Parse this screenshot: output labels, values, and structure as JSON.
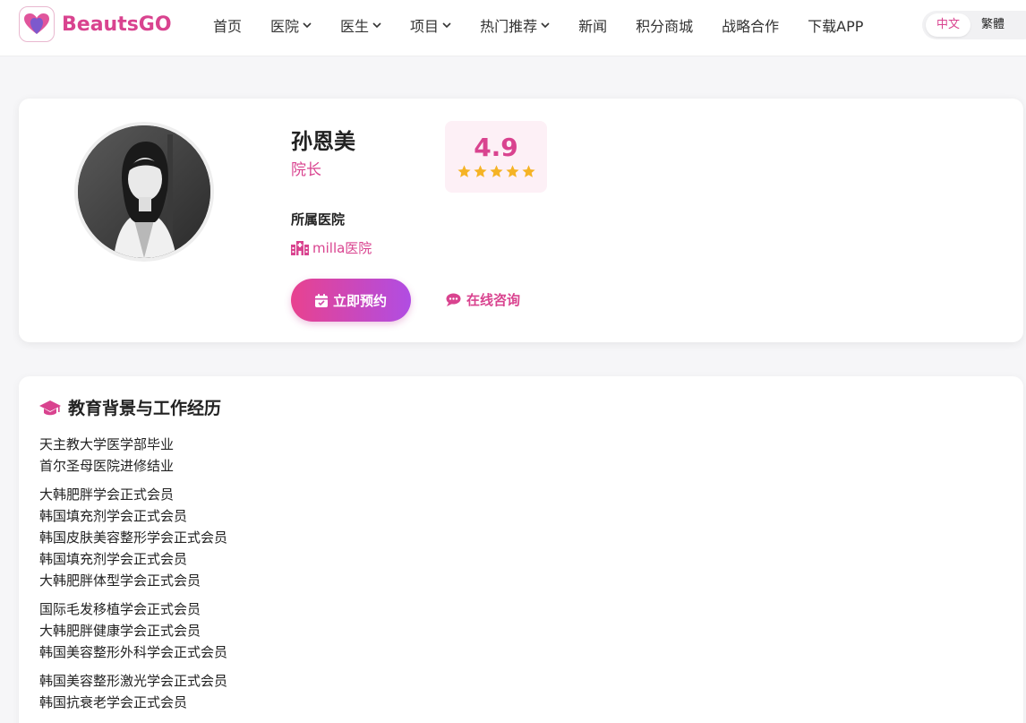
{
  "header": {
    "logo_text": "BeautsGO",
    "nav": [
      {
        "label": "首页",
        "dropdown": false
      },
      {
        "label": "医院",
        "dropdown": true
      },
      {
        "label": "医生",
        "dropdown": true
      },
      {
        "label": "项目",
        "dropdown": true
      },
      {
        "label": "热门推荐",
        "dropdown": true
      },
      {
        "label": "新闻",
        "dropdown": false
      },
      {
        "label": "积分商城",
        "dropdown": false
      },
      {
        "label": "战略合作",
        "dropdown": false
      },
      {
        "label": "下载APP",
        "dropdown": false
      }
    ],
    "lang": {
      "active": "中文",
      "other": "繁體"
    }
  },
  "profile": {
    "name": "孙恩美",
    "title": "院长",
    "rating": "4.9",
    "stars": 5,
    "hospital_label": "所属医院",
    "hospital_name": "milla医院",
    "book_label": "立即预约",
    "consult_label": "在线咨询"
  },
  "education": {
    "title": "教育背景与工作经历",
    "groups": [
      [
        "天主教大学医学部毕业",
        "首尔圣母医院进修结业"
      ],
      [
        "大韩肥胖学会正式会员",
        "韩国填充剂学会正式会员",
        "韩国皮肤美容整形学会正式会员",
        "韩国填充剂学会正式会员",
        "大韩肥胖体型学会正式会员"
      ],
      [
        "国际毛发移植学会正式会员",
        "大韩肥胖健康学会正式会员",
        "韩国美容整形外科学会正式会员"
      ],
      [
        "韩国美容整形激光学会正式会员",
        "韩国抗衰老学会正式会员"
      ]
    ]
  },
  "colors": {
    "brand": "#d9438f",
    "star": "#f5b325",
    "button_gradient_start": "#e8428f",
    "button_gradient_end": "#b04de3"
  },
  "icons": [
    "logo-heart-icon",
    "chevron-down-icon",
    "star-icon",
    "hospital-icon",
    "calendar-icon",
    "chat-icon",
    "graduation-cap-icon"
  ]
}
